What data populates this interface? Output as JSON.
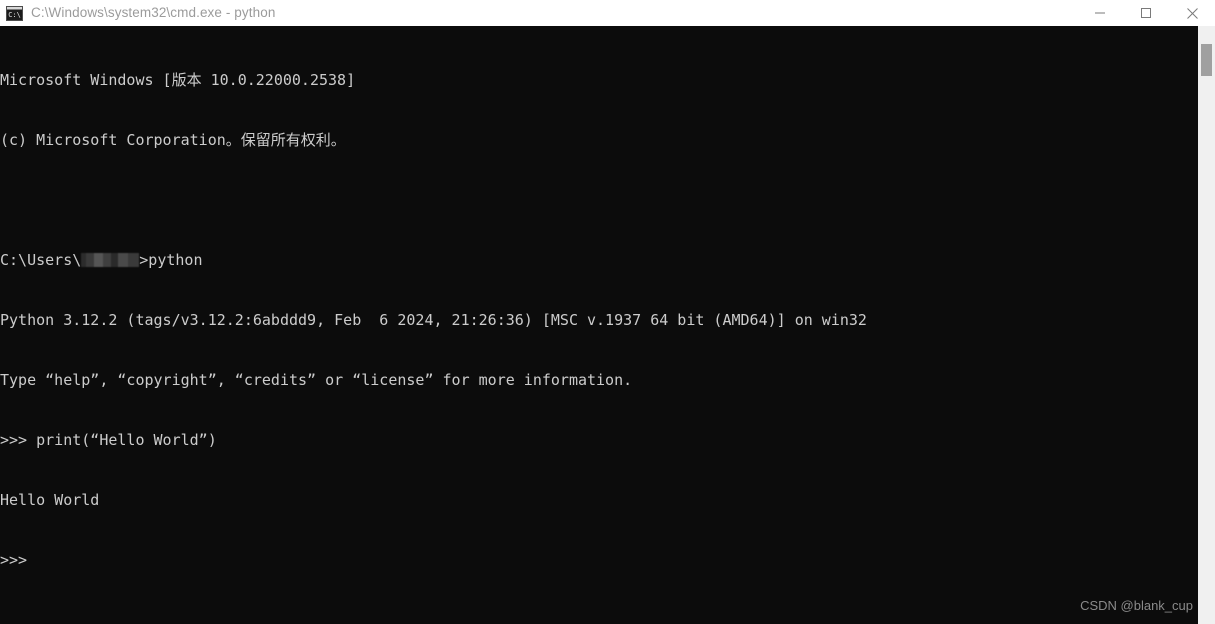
{
  "window": {
    "title": "C:\\Windows\\system32\\cmd.exe - python",
    "icon_name": "cmd-exe-icon",
    "titlebar_bg": "#ffffff",
    "title_color": "#9b9b9b",
    "console_bg": "#0c0c0c",
    "console_fg": "#cccccc"
  },
  "controls": {
    "minimize_label": "Minimize",
    "maximize_label": "Maximize",
    "close_label": "Close"
  },
  "console": {
    "lines": [
      "Microsoft Windows [版本 10.0.22000.2538]",
      "(c) Microsoft Corporation。保留所有权利。",
      "",
      "C:\\Users\\",
      "Python 3.12.2 (tags/v3.12.2:6abddd9, Feb  6 2024, 21:26:36) [MSC v.1937 64 bit (AMD64)] on win32",
      "Type “help”, “copyright”, “credits” or “license” for more information.",
      ">>> print(“Hello World”)",
      "Hello World",
      ">>>"
    ],
    "prompt_line_prefix": "C:\\Users\\",
    "prompt_line_suffix": ">python",
    "redacted_username_label": "redacted-username"
  },
  "scrollbar": {
    "track_color": "#f0f0f0",
    "thumb_color": "#a0a0a0"
  },
  "watermark": {
    "text": "CSDN @blank_cup"
  }
}
